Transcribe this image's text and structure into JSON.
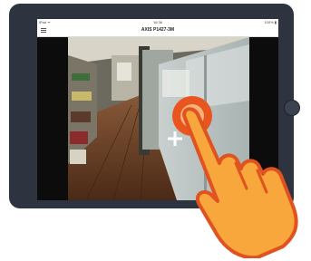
{
  "status_bar": {
    "carrier": "iPad ᯤ",
    "time": "16:36",
    "battery": "100% ▮"
  },
  "nav": {
    "title": "AXIS P1427-3M",
    "menu_icon": "hamburger-menu-icon"
  },
  "video": {
    "overlay_icon": "crosshair-plus-icon"
  },
  "gesture": {
    "icon": "tap-hand-icon",
    "hand_color": "#f7a73c",
    "outline_color": "#e0521f",
    "ring_color": "#e8551e"
  },
  "device": {
    "frame_color": "#2d3440"
  }
}
